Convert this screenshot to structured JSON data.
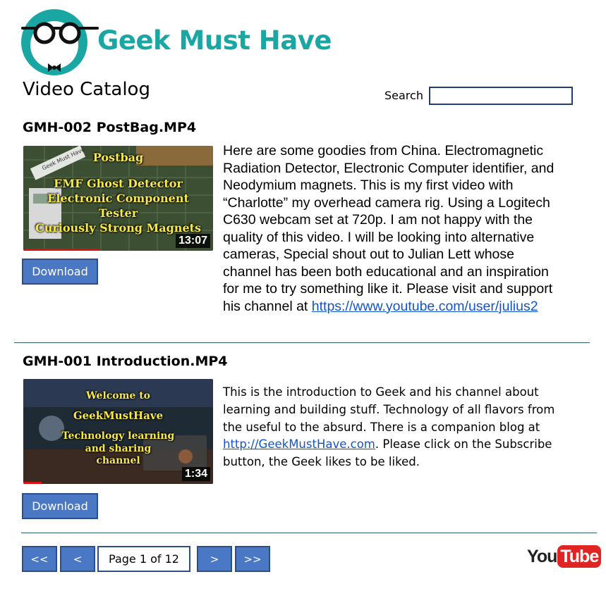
{
  "brand": {
    "name": "Geek Must Have"
  },
  "catalog": {
    "title": "Video Catalog"
  },
  "search": {
    "label": "Search",
    "value": "",
    "placeholder": ""
  },
  "videos": [
    {
      "title": "GMH-002 PostBag.MP4",
      "thumbnail_text": [
        "Postbag",
        "EMF Ghost Detector",
        "Electronic Component",
        "Tester",
        "Curiously Strong Magnets"
      ],
      "thumbnail_watermark": "Geek Must Have",
      "duration": "13:07",
      "download_label": "Download",
      "description": "Here are some goodies from China. Electromagnetic Radiation Detector, Electronic Computer identifier, and Neodymium magnets. This is my first video with “Charlotte” my overhead camera rig. Using a Logitech C630 webcam set at 720p. I am not happy with the quality of this video. I will be looking into alternative cameras, Special shout out to Julian Lett whose channel has been both educational and an inspiration for me to try something like it. Please visit and support his channel at ",
      "link": "https://www.youtube.com/user/julius2",
      "description_after": ""
    },
    {
      "title": "GMH-001 Introduction.MP4",
      "thumbnail_text": [
        "Welcome to",
        "GeekMustHave",
        "Technology learning",
        "and sharing",
        "channel"
      ],
      "duration": "1:34",
      "download_label": "Download",
      "description": "This is the introduction to Geek and his channel about learning and building stuff. Technology of all flavors from the useful to the absurd. There is a companion blog at ",
      "link": "http://GeekMustHave.com",
      "description_after": ". Please click on the Subscribe button, the Geek likes to be liked."
    }
  ],
  "pagination": {
    "first_label": "<<",
    "prev_label": "<",
    "page_text": "Page 1 of 12",
    "next_label": ">",
    "last_label": ">>"
  },
  "youtube": {
    "you": "You",
    "tube": "Tube"
  },
  "colors": {
    "brand_teal": "#1aa7a4",
    "button_blue": "#4a78c4",
    "button_border": "#2c4f8a",
    "link": "#1155cc",
    "youtube_red": "#e02424"
  }
}
